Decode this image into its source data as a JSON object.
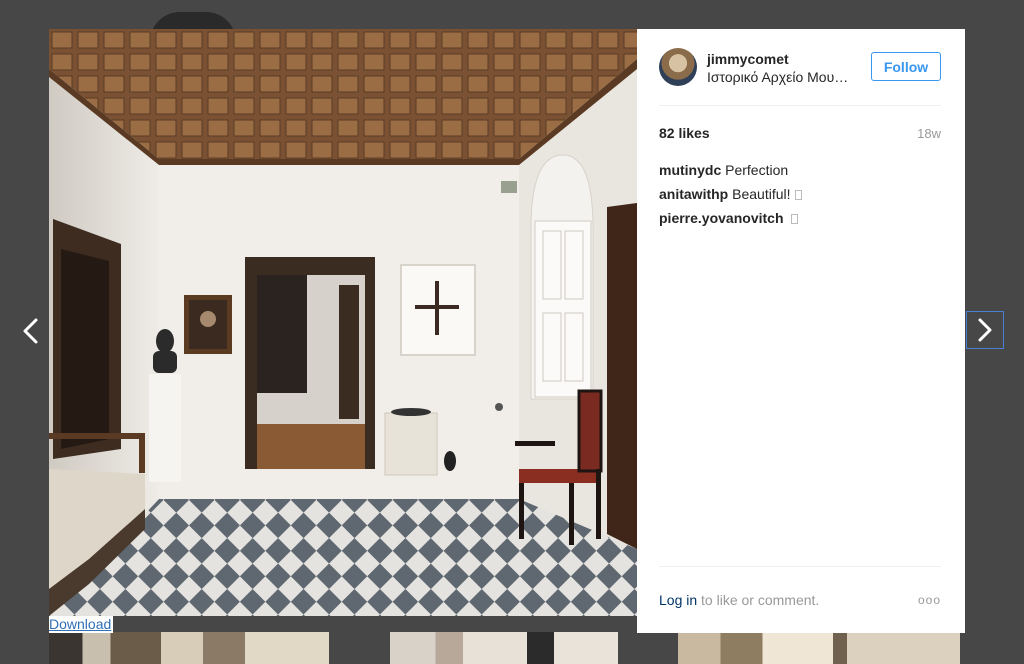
{
  "post": {
    "username": "jimmycomet",
    "location": "Ιστορικό Αρχείο Μουσείο Ύδρας",
    "follow_label": "Follow",
    "likes": "82 likes",
    "time_ago": "18w",
    "comments": [
      {
        "author": "mutinydc",
        "text": "Perfection",
        "emoji": false
      },
      {
        "author": "anitawithp",
        "text": "Beautiful!",
        "emoji": true
      },
      {
        "author": "pierre.yovanovitch",
        "text": "",
        "emoji": true
      }
    ],
    "footer": {
      "login_link": "Log in",
      "login_suffix": " to like or comment.",
      "more_icon": "more-options-icon",
      "more_glyph": "ooo"
    }
  },
  "download_label": "Download",
  "icons": {
    "prev": "chevron-left-icon",
    "next": "chevron-right-icon"
  },
  "colors": {
    "overlay": "#474747",
    "accent": "#3897f0",
    "link": "#003569"
  }
}
